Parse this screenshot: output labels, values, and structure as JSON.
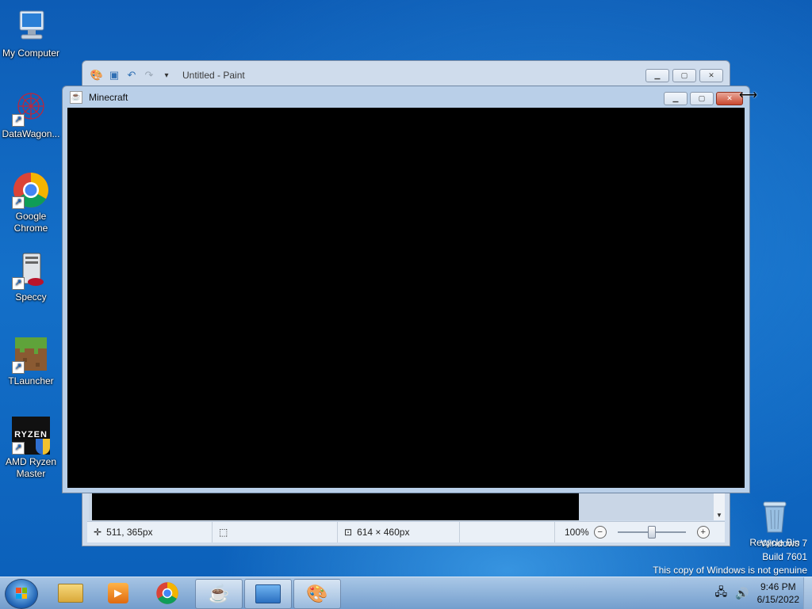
{
  "desktop": {
    "icons": [
      {
        "label": "My Computer",
        "icon": "computer-icon"
      },
      {
        "label": "DataWagon...",
        "icon": "datawagon-icon"
      },
      {
        "label": "Google Chrome",
        "icon": "chrome-icon"
      },
      {
        "label": "Speccy",
        "icon": "speccy-icon"
      },
      {
        "label": "TLauncher",
        "icon": "grass-block-icon"
      },
      {
        "label": "AMD Ryzen Master",
        "icon": "ryzen-icon"
      }
    ],
    "recycle_bin": "Recycle Bin",
    "ryzen_text": "RYZEN"
  },
  "paint": {
    "title": "Untitled - Paint",
    "status": {
      "cursor_pos": "511, 365px",
      "canvas_size": "614 × 460px",
      "zoom": "100%"
    }
  },
  "minecraft": {
    "title": "Minecraft"
  },
  "watermark": {
    "line1": "Windows 7",
    "line2": "Build 7601",
    "line3": "This copy of Windows is not genuine"
  },
  "taskbar": {
    "items": [
      "file-explorer-icon",
      "media-player-icon",
      "chrome-icon",
      "java-icon",
      "control-panel-icon",
      "paint-icon"
    ],
    "time": "9:46 PM",
    "date": "6/15/2022"
  },
  "colors": {
    "desktop_blue": "#1470c9",
    "close_red": "#c9482f"
  }
}
